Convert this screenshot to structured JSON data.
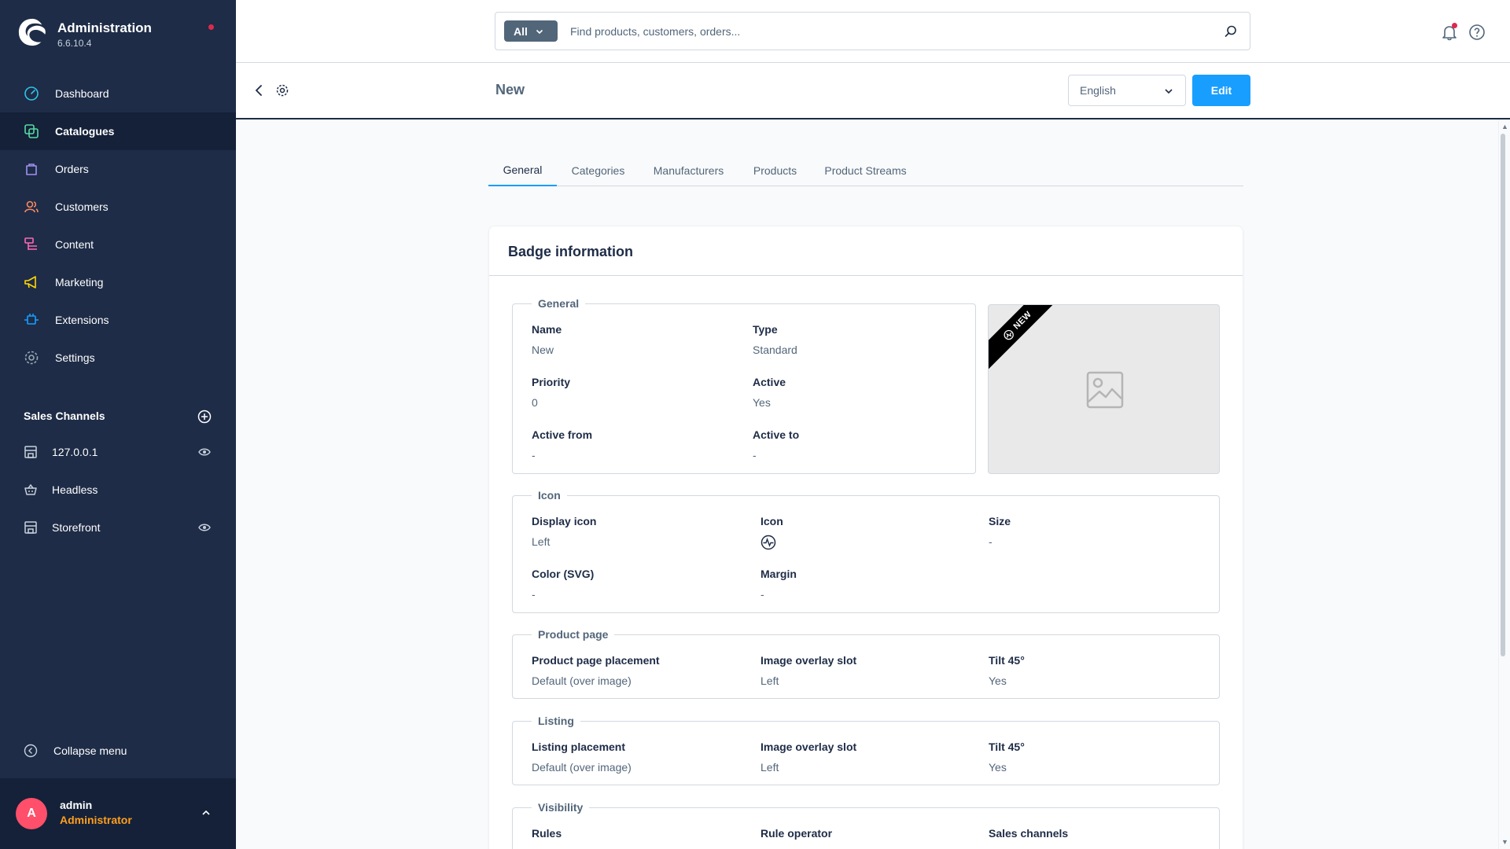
{
  "app": {
    "title": "Administration",
    "version": "6.6.10.4"
  },
  "nav": {
    "items": [
      {
        "label": "Dashboard"
      },
      {
        "label": "Catalogues"
      },
      {
        "label": "Orders"
      },
      {
        "label": "Customers"
      },
      {
        "label": "Content"
      },
      {
        "label": "Marketing"
      },
      {
        "label": "Extensions"
      },
      {
        "label": "Settings"
      }
    ]
  },
  "sales_channels": {
    "title": "Sales Channels",
    "items": [
      {
        "label": "127.0.0.1"
      },
      {
        "label": "Headless"
      },
      {
        "label": "Storefront"
      }
    ]
  },
  "collapse_label": "Collapse menu",
  "user": {
    "initial": "A",
    "name": "admin",
    "role": "Administrator"
  },
  "search": {
    "type_label": "All",
    "placeholder": "Find products, customers, orders..."
  },
  "smartbar": {
    "title": "New",
    "language": "English",
    "edit_label": "Edit"
  },
  "tabs": [
    {
      "label": "General"
    },
    {
      "label": "Categories"
    },
    {
      "label": "Manufacturers"
    },
    {
      "label": "Products"
    },
    {
      "label": "Product Streams"
    }
  ],
  "card": {
    "title": "Badge information",
    "general": {
      "legend": "General",
      "name_label": "Name",
      "name_value": "New",
      "type_label": "Type",
      "type_value": "Standard",
      "priority_label": "Priority",
      "priority_value": "0",
      "active_label": "Active",
      "active_value": "Yes",
      "active_from_label": "Active from",
      "active_from_value": "-",
      "active_to_label": "Active to",
      "active_to_value": "-"
    },
    "preview": {
      "ribbon_text": "NEW"
    },
    "icon": {
      "legend": "Icon",
      "display_label": "Display icon",
      "display_value": "Left",
      "icon_label": "Icon",
      "size_label": "Size",
      "size_value": "-",
      "color_label": "Color (SVG)",
      "color_value": "-",
      "margin_label": "Margin",
      "margin_value": "-"
    },
    "product_page": {
      "legend": "Product page",
      "placement_label": "Product page placement",
      "placement_value": "Default (over image)",
      "slot_label": "Image overlay slot",
      "slot_value": "Left",
      "tilt_label": "Tilt 45°",
      "tilt_value": "Yes"
    },
    "listing": {
      "legend": "Listing",
      "placement_label": "Listing placement",
      "placement_value": "Default (over image)",
      "slot_label": "Image overlay slot",
      "slot_value": "Left",
      "tilt_label": "Tilt 45°",
      "tilt_value": "Yes"
    },
    "visibility": {
      "legend": "Visibility",
      "rules_label": "Rules",
      "operator_label": "Rule operator",
      "channels_label": "Sales channels"
    }
  },
  "colors": {
    "sidebar_bg": "#1e2c47",
    "sidebar_active": "#142139",
    "primary": "#189eff",
    "text": "#52667a",
    "heading": "#1e2c47",
    "notification_dot": "#de294c",
    "role_color": "#ff9f1c",
    "avatar_bg": "#ff4f6a"
  }
}
